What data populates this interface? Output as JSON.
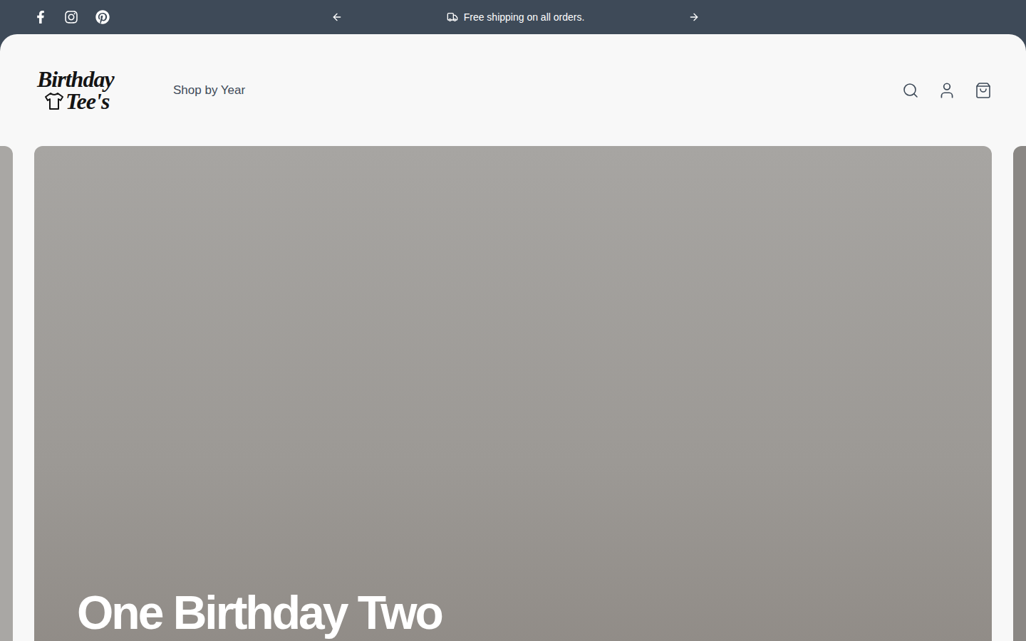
{
  "announcement_bar": {
    "message": "Free shipping on all orders."
  },
  "header": {
    "logo": {
      "line1": "Birthday",
      "line2": "Tee's"
    },
    "nav": [
      {
        "label": "Shop by Year",
        "selected": false
      }
    ]
  },
  "hero": {
    "heading": "One Birthday Two"
  }
}
